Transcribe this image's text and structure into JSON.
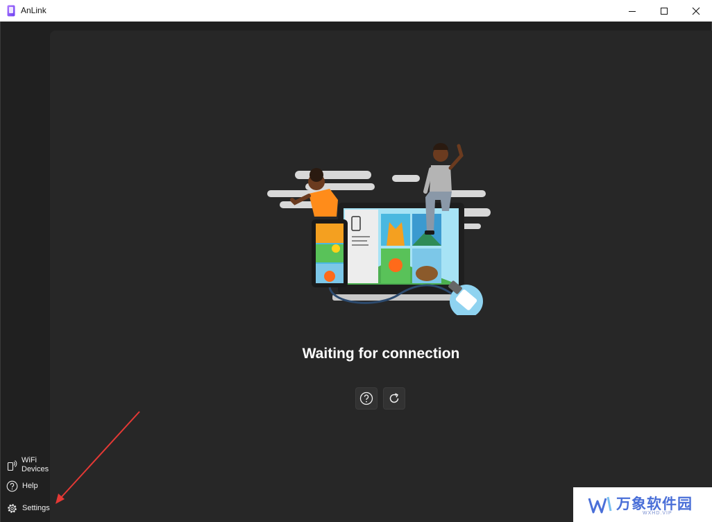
{
  "window": {
    "title": "AnLink"
  },
  "sidebar": {
    "items": [
      {
        "label_line1": "WiFi",
        "label_line2": "Devices",
        "icon": "phone-wifi-icon"
      },
      {
        "label": "Help",
        "icon": "help-circle-icon"
      },
      {
        "label": "Settings",
        "icon": "gear-icon"
      }
    ]
  },
  "main": {
    "status_text": "Waiting for connection",
    "actions": [
      {
        "icon": "help-circle-icon"
      },
      {
        "icon": "refresh-icon"
      }
    ]
  },
  "watermark": {
    "text": "万象软件园",
    "sub": "WXHD.VIP"
  },
  "colors": {
    "background": "#202020",
    "content": "#272727",
    "annotation_arrow": "#e53935",
    "watermark": "#4a6fd8"
  }
}
